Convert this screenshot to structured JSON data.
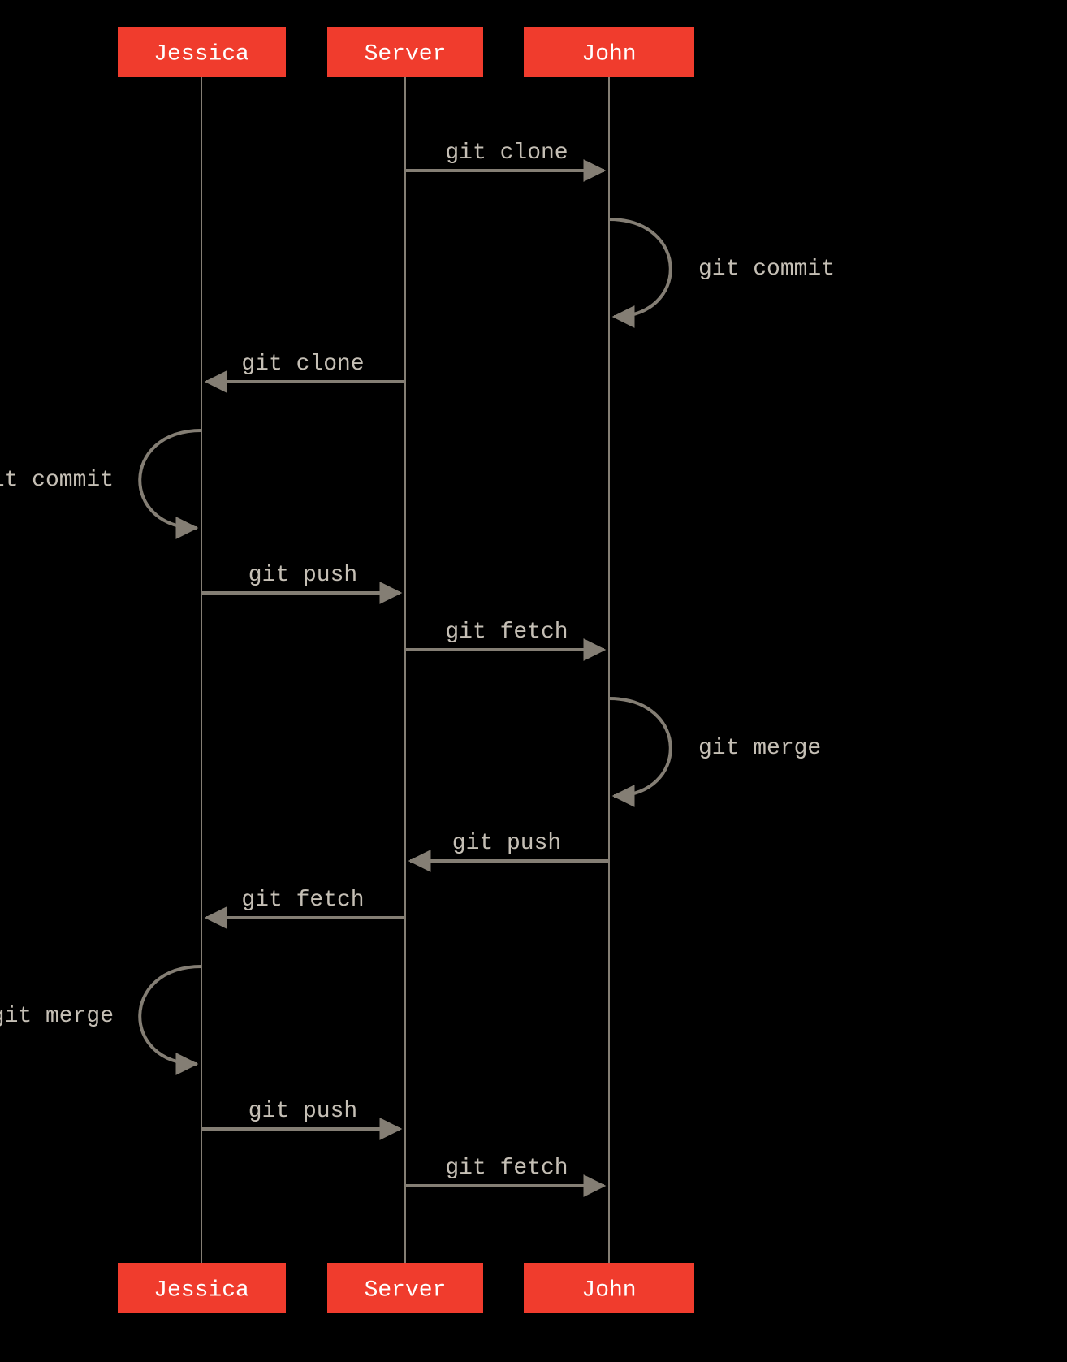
{
  "actors": {
    "jessica": "Jessica",
    "server": "Server",
    "john": "John"
  },
  "messages": {
    "m1": "git clone",
    "m2": "git commit",
    "m3": "git clone",
    "m4": "git commit",
    "m5": "git push",
    "m6": "git fetch",
    "m7": "git merge",
    "m8": "git push",
    "m9": "git fetch",
    "m10": "git merge",
    "m11": "git push",
    "m12": "git fetch"
  },
  "colors": {
    "actor_fill": "#f03c2d",
    "line": "#847e74",
    "text": "#c5bfb5",
    "bg": "#000000"
  },
  "chart_data": {
    "type": "sequence-diagram",
    "actors": [
      "Jessica",
      "Server",
      "John"
    ],
    "interactions": [
      {
        "from": "Server",
        "to": "John",
        "label": "git clone"
      },
      {
        "from": "John",
        "to": "John",
        "label": "git commit"
      },
      {
        "from": "Server",
        "to": "Jessica",
        "label": "git clone"
      },
      {
        "from": "Jessica",
        "to": "Jessica",
        "label": "git commit"
      },
      {
        "from": "Jessica",
        "to": "Server",
        "label": "git push"
      },
      {
        "from": "Server",
        "to": "John",
        "label": "git fetch"
      },
      {
        "from": "John",
        "to": "John",
        "label": "git merge"
      },
      {
        "from": "John",
        "to": "Server",
        "label": "git push"
      },
      {
        "from": "Server",
        "to": "Jessica",
        "label": "git fetch"
      },
      {
        "from": "Jessica",
        "to": "Jessica",
        "label": "git merge"
      },
      {
        "from": "Jessica",
        "to": "Server",
        "label": "git push"
      },
      {
        "from": "Server",
        "to": "John",
        "label": "git fetch"
      }
    ]
  }
}
